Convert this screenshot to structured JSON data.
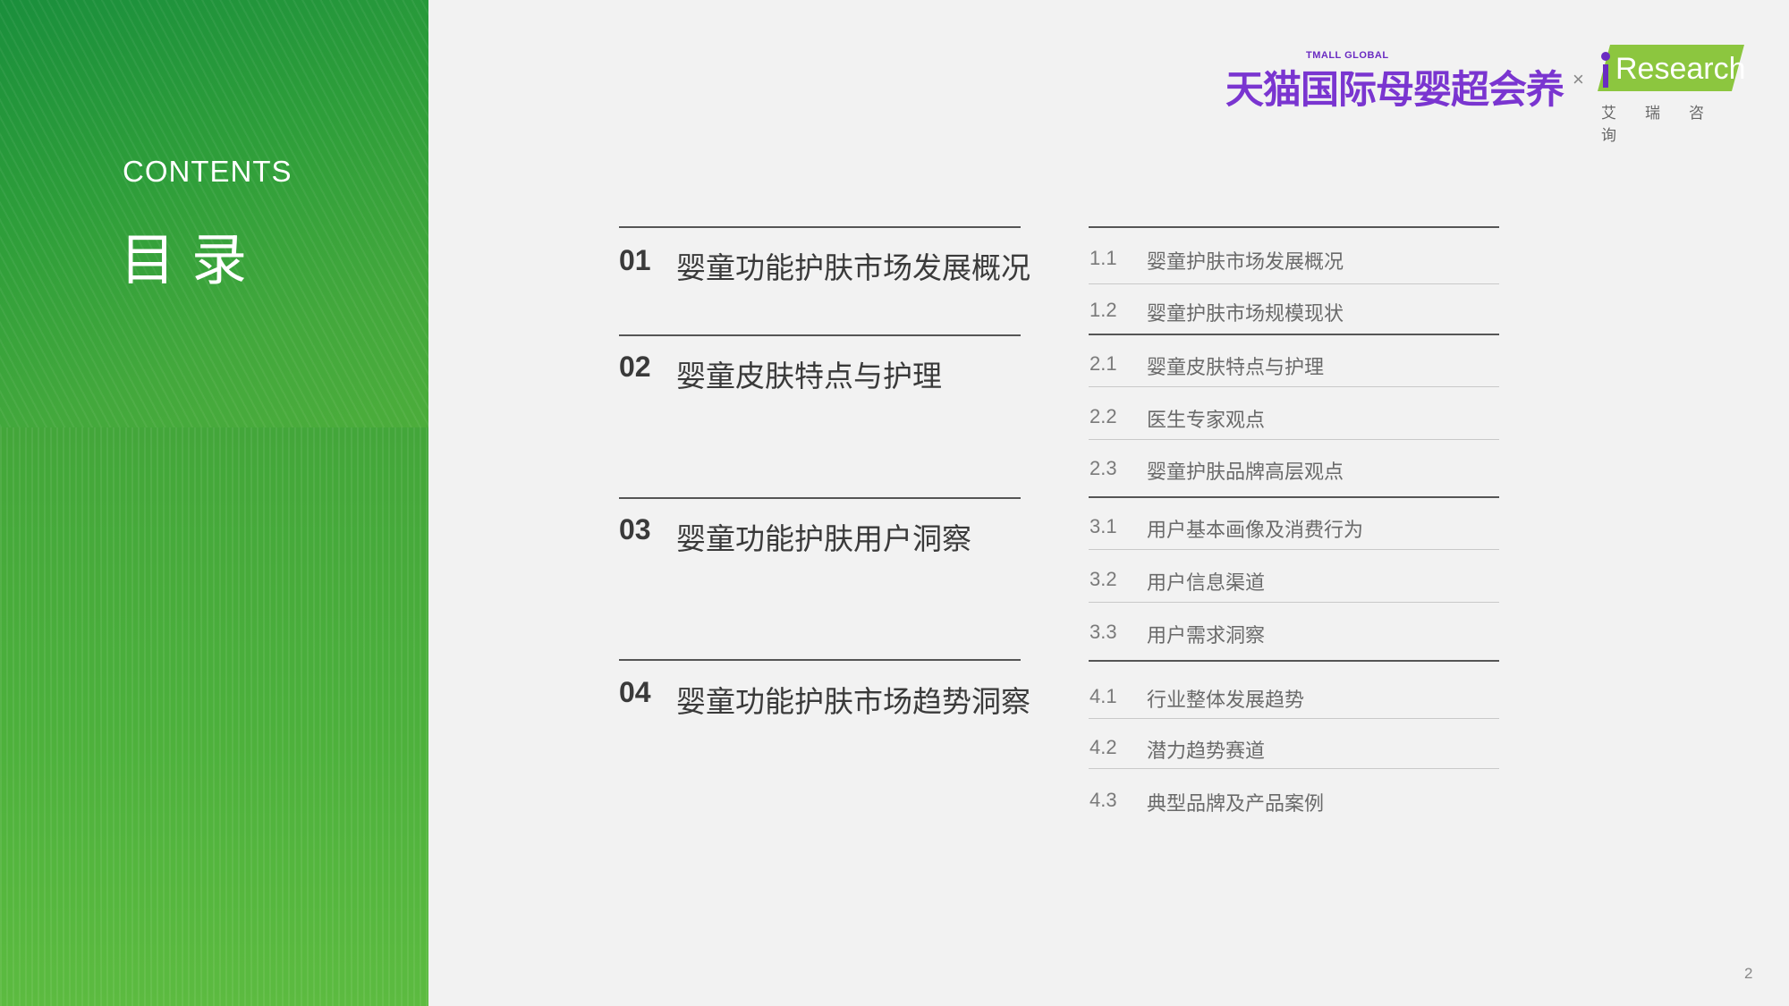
{
  "header": {
    "contents_en": "CONTENTS",
    "contents_cn": "目录"
  },
  "logo": {
    "tmall_small": "TMALL GLOBAL",
    "tmall_main": "天猫国际母婴超会养",
    "separator": "×",
    "iresearch": "Research",
    "iresearch_cn": "艾瑞咨询",
    "colors": {
      "tmall": "#7a35d0",
      "iresearch_badge": "#8cc63f"
    }
  },
  "sections": [
    {
      "num": "01",
      "title": "婴童功能护肤市场发展概况",
      "items": [
        {
          "num": "1.1",
          "title": "婴童护肤市场发展概况"
        },
        {
          "num": "1.2",
          "title": "婴童护肤市场规模现状"
        }
      ]
    },
    {
      "num": "02",
      "title": "婴童皮肤特点与护理",
      "items": [
        {
          "num": "2.1",
          "title": "婴童皮肤特点与护理"
        },
        {
          "num": "2.2",
          "title": "医生专家观点"
        },
        {
          "num": "2.3",
          "title": "婴童护肤品牌高层观点"
        }
      ]
    },
    {
      "num": "03",
      "title": "婴童功能护肤用户洞察",
      "items": [
        {
          "num": "3.1",
          "title": "用户基本画像及消费行为"
        },
        {
          "num": "3.2",
          "title": "用户信息渠道"
        },
        {
          "num": "3.3",
          "title": "用户需求洞察"
        }
      ]
    },
    {
      "num": "04",
      "title": "婴童功能护肤市场趋势洞察",
      "items": [
        {
          "num": "4.1",
          "title": "行业整体发展趋势"
        },
        {
          "num": "4.2",
          "title": "潜力趋势赛道"
        },
        {
          "num": "4.3",
          "title": "典型品牌及产品案例"
        }
      ]
    }
  ],
  "page_number": "2",
  "colors": {
    "panel_green": "#3fa53b",
    "background": "#f2f2f2",
    "text_dark": "#3a3a3a"
  }
}
